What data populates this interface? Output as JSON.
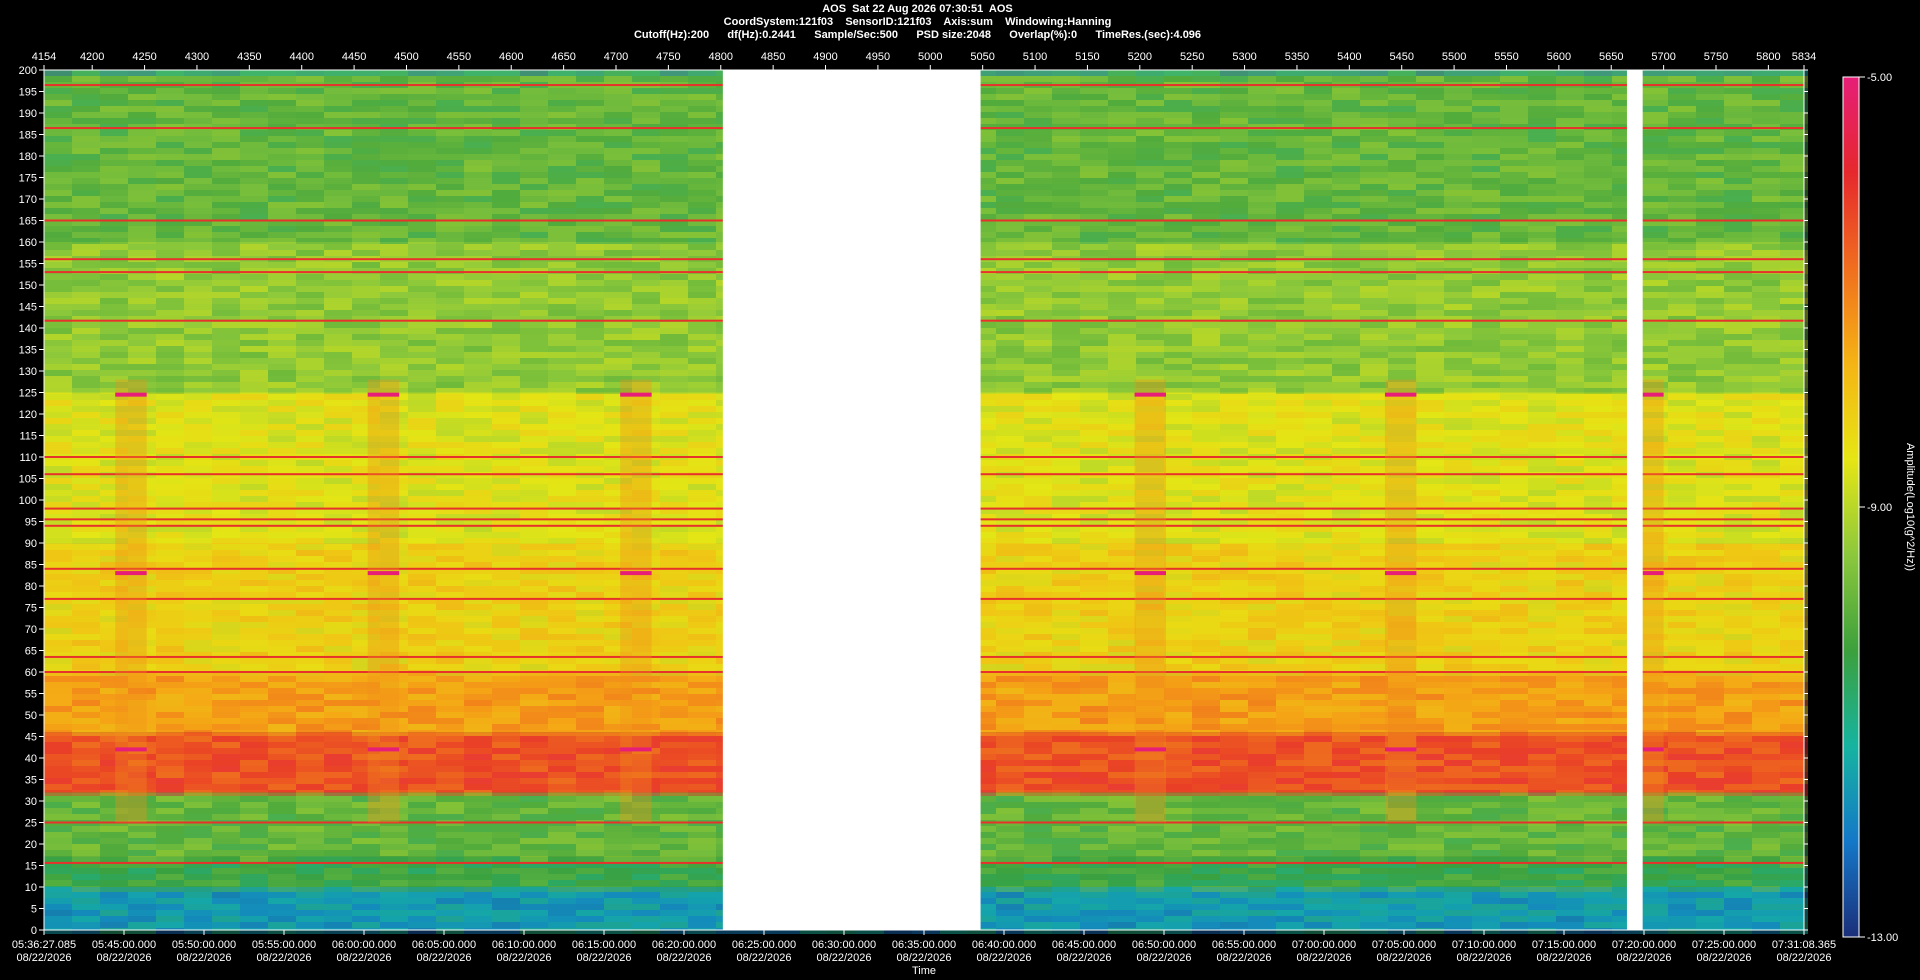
{
  "header": {
    "line1": "AOS  Sat 22 Aug 2026 07:30:51  AOS",
    "line2": "CoordSystem:121f03    SensorID:121f03    Axis:sum    Windowing:Hanning",
    "line3": "Cutoff(Hz):200      df(Hz):0.2441      Sample/Sec:500      PSD size:2048      Overlap(%):0      TimeRes.(sec):4.096"
  },
  "chart_data": {
    "type": "heatmap",
    "title": "AOS  Sat 22 Aug 2026 07:30:51  AOS",
    "xlabel": "Time",
    "ylabel": "",
    "colorbar_label": "Amplitude(Log10(g^2/Hz))",
    "ylim": [
      0,
      200
    ],
    "y_ticks": [
      0,
      5,
      10,
      15,
      20,
      25,
      30,
      35,
      40,
      45,
      50,
      55,
      60,
      65,
      70,
      75,
      80,
      85,
      90,
      95,
      100,
      105,
      110,
      115,
      120,
      125,
      130,
      135,
      140,
      145,
      150,
      155,
      160,
      165,
      170,
      175,
      180,
      185,
      190,
      195,
      200
    ],
    "top_axis": {
      "range": [
        4154,
        5834
      ],
      "ticks": [
        4154,
        4200,
        4250,
        4300,
        4350,
        4400,
        4450,
        4500,
        4550,
        4600,
        4650,
        4700,
        4750,
        4800,
        4850,
        4900,
        4950,
        5000,
        5050,
        5100,
        5150,
        5200,
        5250,
        5300,
        5350,
        5400,
        5450,
        5500,
        5550,
        5600,
        5650,
        5700,
        5750,
        5800,
        5834
      ]
    },
    "bottom_axis": {
      "date": "08/22/2026",
      "ticks": [
        "05:36:27.085",
        "05:45:00.000",
        "05:50:00.000",
        "05:55:00.000",
        "06:00:00.000",
        "06:05:00.000",
        "06:10:00.000",
        "06:15:00.000",
        "06:20:00.000",
        "06:25:00.000",
        "06:30:00.000",
        "06:35:00.000",
        "06:40:00.000",
        "06:45:00.000",
        "06:50:00.000",
        "06:55:00.000",
        "07:00:00.000",
        "07:05:00.000",
        "07:10:00.000",
        "07:15:00.000",
        "07:20:00.000",
        "07:25:00.000",
        "07:31:08.365"
      ]
    },
    "colorbar": {
      "min": -13.0,
      "max": -5.0,
      "ticks": [
        {
          "value": -5.0,
          "label": "-5.00"
        },
        {
          "value": -9.0,
          "label": "-9.00"
        },
        {
          "value": -13.0,
          "label": "-13.00"
        }
      ],
      "colors": [
        "#1b2f7a",
        "#1478c8",
        "#16b4a0",
        "#3ca03c",
        "#8cc83c",
        "#e6e614",
        "#f5b414",
        "#f06e1e",
        "#e6282d",
        "#e61e78"
      ]
    },
    "data_gaps": [
      [
        4802,
        5048
      ],
      [
        5665,
        5680
      ]
    ],
    "spectral_lines_hz": [
      15.6,
      25.0,
      60.0,
      63.5,
      77.0,
      84.0,
      94.0,
      95.5,
      98.0,
      106.0,
      110.0,
      141.7,
      153.0,
      156.0,
      165.0,
      186.5,
      196.5
    ],
    "bands": [
      {
        "from_hz": 0,
        "to_hz": 10,
        "level": -11.6
      },
      {
        "from_hz": 10,
        "to_hz": 17,
        "level": -10.4
      },
      {
        "from_hz": 17,
        "to_hz": 32,
        "level": -9.9
      },
      {
        "from_hz": 32,
        "to_hz": 46,
        "level": -6.4
      },
      {
        "from_hz": 46,
        "to_hz": 60,
        "level": -7.4
      },
      {
        "from_hz": 60,
        "to_hz": 90,
        "level": -8.2
      },
      {
        "from_hz": 90,
        "to_hz": 125,
        "level": -8.6
      },
      {
        "from_hz": 125,
        "to_hz": 160,
        "level": -9.4
      },
      {
        "from_hz": 160,
        "to_hz": 200,
        "level": -9.9
      }
    ],
    "event_windows": [
      [
        4222,
        4252
      ],
      [
        4463,
        4493
      ],
      [
        4704,
        4734
      ],
      [
        5195,
        5225
      ],
      [
        5434,
        5464
      ],
      [
        5680,
        5700
      ]
    ],
    "event_lines_hz": [
      42.0,
      83.0,
      124.5
    ]
  }
}
